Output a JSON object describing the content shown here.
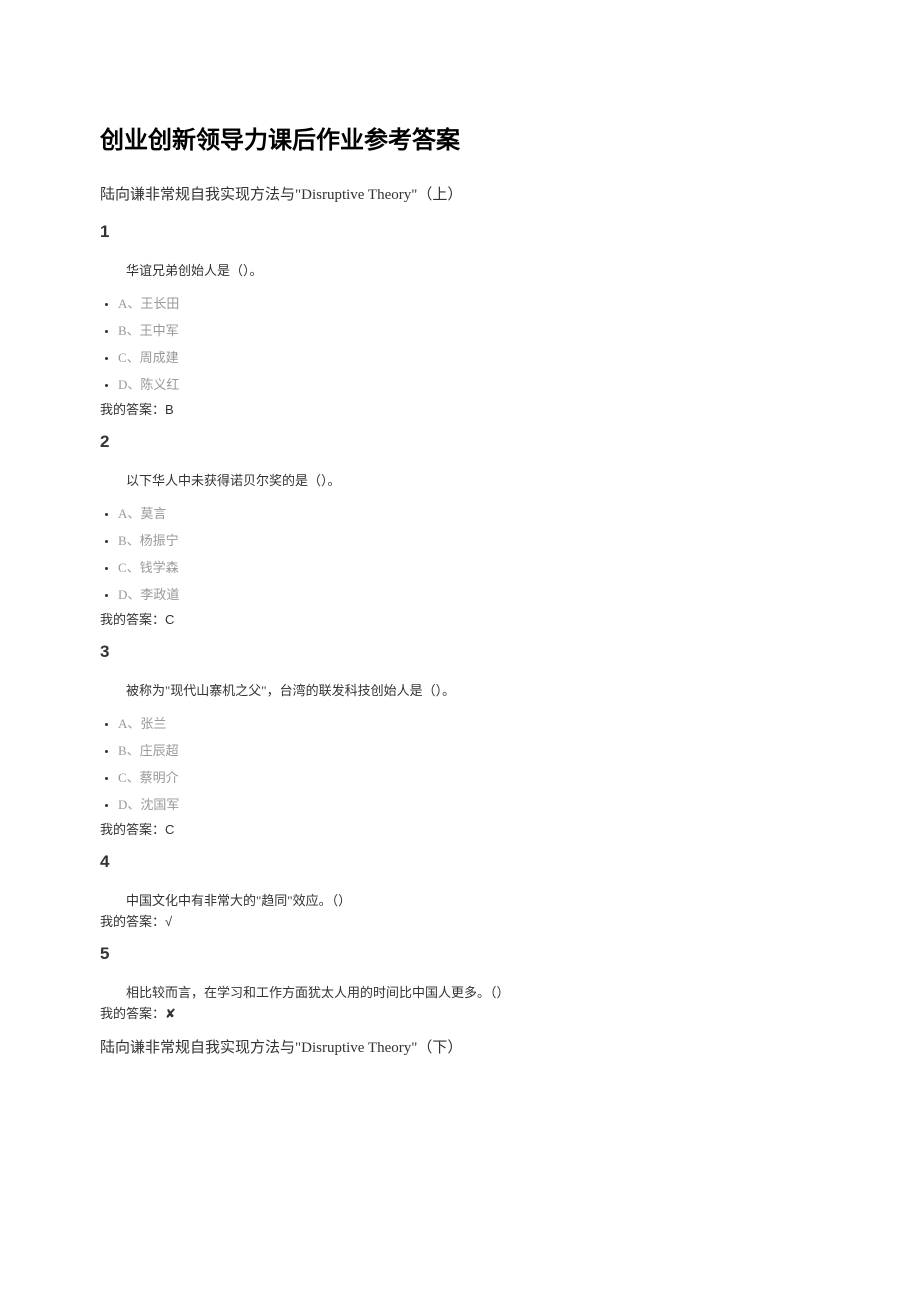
{
  "title": "创业创新领导力课后作业参考答案",
  "section1": "陆向谦非常规自我实现方法与\"Disruptive Theory\"（上）",
  "section2": "陆向谦非常规自我实现方法与\"Disruptive Theory\"（下）",
  "answer_prefix": "我的答案：",
  "q1": {
    "num": "1",
    "text": "华谊兄弟创始人是（）。",
    "opts": [
      "A、王长田",
      "B、王中军",
      "C、周成建",
      "D、陈义红"
    ],
    "answer": "B"
  },
  "q2": {
    "num": "2",
    "text": "以下华人中未获得诺贝尔奖的是（）。",
    "opts": [
      "A、莫言",
      "B、杨振宁",
      "C、钱学森",
      "D、李政道"
    ],
    "answer": "C"
  },
  "q3": {
    "num": "3",
    "text": "被称为\"现代山寨机之父\"，台湾的联发科技创始人是（）。",
    "opts": [
      "A、张兰",
      "B、庄辰超",
      "C、蔡明介",
      "D、沈国军"
    ],
    "answer": "C"
  },
  "q4": {
    "num": "4",
    "text": "中国文化中有非常大的\"趋同\"效应。（）",
    "answer": "√"
  },
  "q5": {
    "num": "5",
    "text": "相比较而言，在学习和工作方面犹太人用的时间比中国人更多。（）",
    "answer": "✘"
  }
}
